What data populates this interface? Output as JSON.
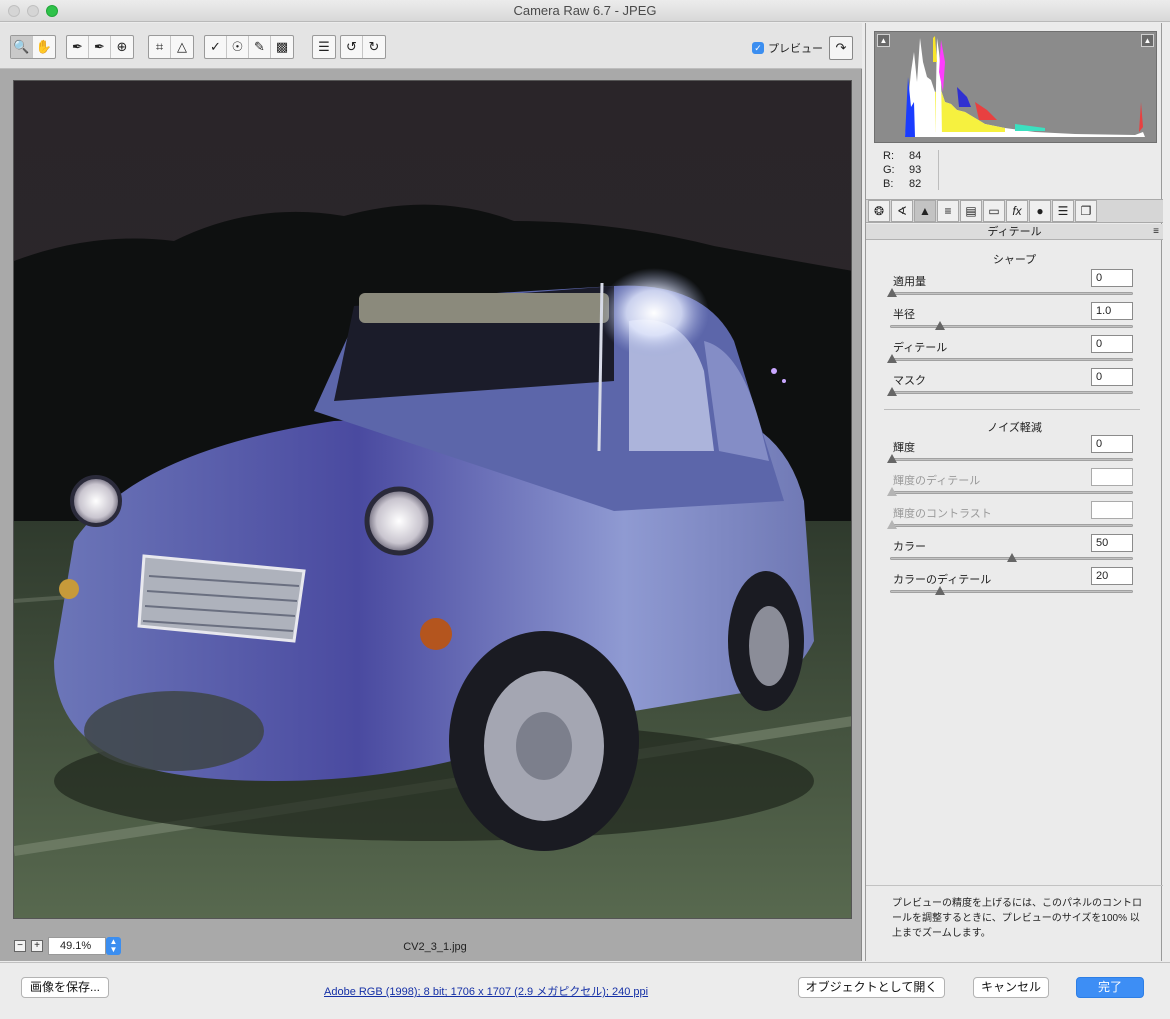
{
  "window": {
    "title": "Camera Raw 6.7  -  JPEG"
  },
  "toolbar": {
    "tools": [
      "zoom-icon",
      "hand-icon",
      "white-balance-icon",
      "color-sampler-icon",
      "target-adjust-icon",
      "crop-icon",
      "straighten-icon",
      "spot-removal-icon",
      "red-eye-icon",
      "adjustment-brush-icon",
      "graduated-filter-icon",
      "preferences-icon",
      "rotate-left-icon",
      "rotate-right-icon"
    ],
    "preview_label": "プレビュー",
    "preview_checked": true
  },
  "image": {
    "filename": "CV2_3_1.jpg"
  },
  "zoom": {
    "value": "49.1%",
    "minus": "−",
    "plus": "+"
  },
  "histogram": {
    "r_label": "R:",
    "r": "84",
    "g_label": "G:",
    "g": "93",
    "b_label": "B:",
    "b": "82"
  },
  "panel": {
    "title": "ディテール",
    "menu_icon": "≡",
    "tabs": [
      "basic-icon",
      "tone-curve-icon",
      "detail-icon",
      "hsl-icon",
      "split-toning-icon",
      "lens-icon",
      "fx-icon",
      "camera-calibration-icon",
      "presets-icon",
      "snapshots-icon"
    ],
    "sharpen": {
      "title": "シャープ",
      "rows": [
        {
          "label": "適用量",
          "value": "0",
          "level": 0.0,
          "disabled": false
        },
        {
          "label": "半径",
          "value": "1.0",
          "level": 0.2,
          "disabled": false
        },
        {
          "label": "ディテール",
          "value": "0",
          "level": 0.0,
          "disabled": false
        },
        {
          "label": "マスク",
          "value": "0",
          "level": 0.0,
          "disabled": false
        }
      ]
    },
    "noise": {
      "title": "ノイズ軽減",
      "rows": [
        {
          "label": "輝度",
          "value": "0",
          "level": 0.0,
          "disabled": false
        },
        {
          "label": "輝度のディテール",
          "value": "",
          "level": 0.0,
          "disabled": true
        },
        {
          "label": "輝度のコントラスト",
          "value": "",
          "level": 0.0,
          "disabled": true
        },
        {
          "label": "カラー",
          "value": "50",
          "level": 0.5,
          "disabled": false
        },
        {
          "label": "カラーのディテール",
          "value": "20",
          "level": 0.2,
          "disabled": false
        }
      ]
    },
    "note": "プレビューの精度を上げるには、このパネルのコントロールを調整するときに、プレビューのサイズを100% 以上までズームします。"
  },
  "footer": {
    "save_label": "画像を保存...",
    "info": "Adobe RGB (1998); 8 bit; 1706 x 1707 (2.9 メガピクセル); 240 ppi",
    "open_object_label": "オブジェクトとして開く",
    "cancel_label": "キャンセル",
    "done_label": "完了"
  },
  "colors": {
    "accent": "#3d8ef5",
    "link": "#1530a6"
  }
}
